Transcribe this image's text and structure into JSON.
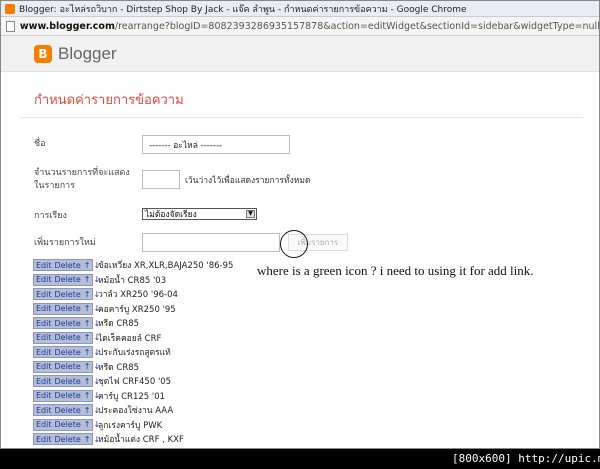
{
  "window": {
    "title": "Blogger: อะไหล่รถวิบาก - Dirtstep Shop By Jack - แจ๊ค ลำพูน - กำหนดค่ารายการข้อความ - Google Chrome"
  },
  "address": {
    "host": "www.blogger.com",
    "path": "/rearrange?blogID=8082393286935157878&action=editWidget&sectionId=sidebar&widgetType=null&"
  },
  "brand": {
    "logo_letter": "B",
    "name": "Blogger",
    "accent": "#f57d00"
  },
  "page": {
    "heading": "กำหนดค่ารายการข้อความ",
    "heading_color": "#dd4b39"
  },
  "form": {
    "title_label": "ชื่อ",
    "title_value": "------- อะไหล่ -------",
    "count_label_1": "จำนวนรายการที่จะแสดง",
    "count_label_2": "ในรายการ",
    "count_value": "",
    "count_hint": "เว้นว่างไว้เพื่อแสดงรายการทั้งหมด",
    "sort_label": "การเรียง",
    "sort_value": "ไม่ต้องจัดเรียง",
    "new_item_label": "เพิ่มรายการใหม่",
    "new_item_value": "",
    "add_button": "เพิ่มรายการ"
  },
  "item_controls": {
    "edit": "Edit",
    "delete": "Delete",
    "up": "↑",
    "down": "↓"
  },
  "items": [
    "ข้อเหวี่ยง XR,XLR,BAJA250 '86-95",
    "หม้อน้ำ CR85 '03",
    "วาล์ว XR250 '96-04",
    "คอคาร์บู XR250 '95",
    "หรีด CR85",
    "ไดเร็คคอยล์ CRF",
    "ประกับเร่งรถสูตรแท้",
    "หรีด CR85",
    "ชุดไฟ CRF450 '05",
    "คาร์บู CR125 '01",
    "ประคองโซ่งาน AAA",
    "ลูกเร่งคาร์บู PWK",
    "หม้อน้ำแต่ง CRF , KXF"
  ],
  "annotation": "where is a green icon ? i need to using it for add link.",
  "footer": "[800x600] http://upic.me/"
}
